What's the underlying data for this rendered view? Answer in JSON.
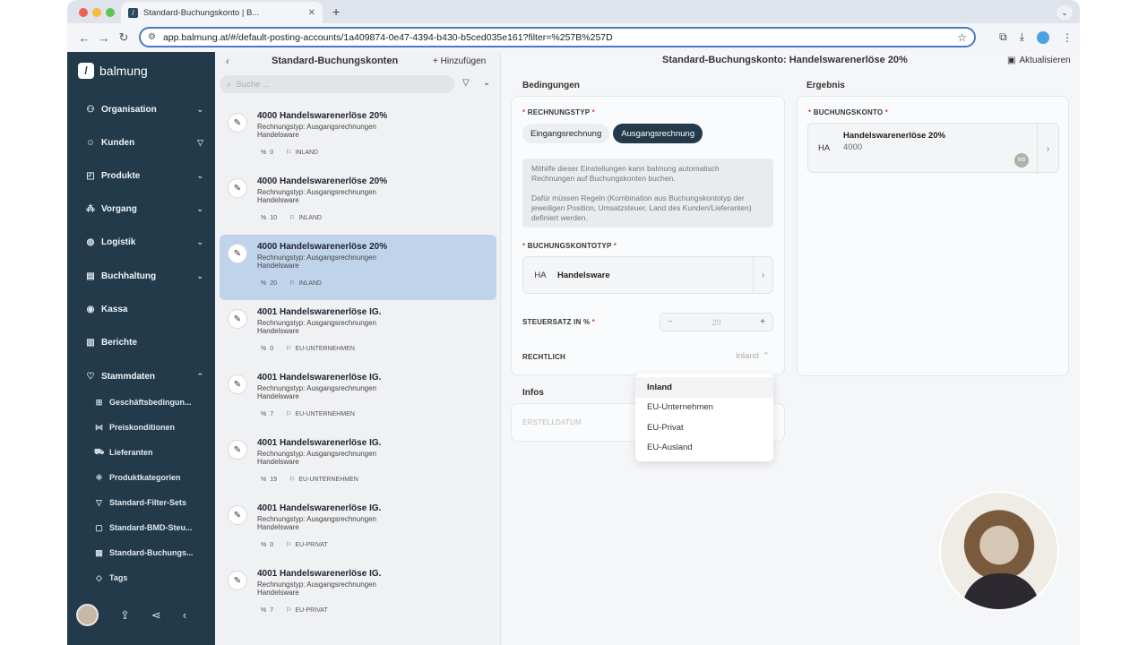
{
  "browser": {
    "tab_title": "Standard-Buchungskonto | B...",
    "url": "app.balmung.at/#/default-posting-accounts/1a409874-0e47-4394-b430-b5ced035e161?filter=%257B%257D"
  },
  "sidebar": {
    "brand": "balmung",
    "items": [
      {
        "label": "Organisation",
        "icon": "org-icon"
      },
      {
        "label": "Kunden",
        "icon": "people-icon"
      },
      {
        "label": "Produkte",
        "icon": "bag-icon"
      },
      {
        "label": "Vorgang",
        "icon": "flow-icon"
      },
      {
        "label": "Logistik",
        "icon": "globe-icon"
      },
      {
        "label": "Buchhaltung",
        "icon": "ledger-icon"
      },
      {
        "label": "Kassa",
        "icon": "coin-icon"
      },
      {
        "label": "Berichte",
        "icon": "chart-icon"
      },
      {
        "label": "Stammdaten",
        "icon": "heart-icon"
      }
    ],
    "subitems": [
      {
        "label": "Geschäftsbedingun..."
      },
      {
        "label": "Preiskonditionen"
      },
      {
        "label": "Lieferanten"
      },
      {
        "label": "Produktkategorien"
      },
      {
        "label": "Standard-Filter-Sets"
      },
      {
        "label": "Standard-BMD-Steu..."
      },
      {
        "label": "Standard-Buchungs..."
      },
      {
        "label": "Tags"
      }
    ]
  },
  "list": {
    "title": "Standard-Buchungskonten",
    "add_label": "Hinzufügen",
    "search_placeholder": "Suche ...",
    "items": [
      {
        "title": "4000 Handelswarenerlöse 20%",
        "line1": "Rechnungstyp: Ausgangsrechnungen",
        "line2": "Handelsware",
        "tax": "0",
        "region": "INLAND"
      },
      {
        "title": "4000 Handelswarenerlöse 20%",
        "line1": "Rechnungstyp: Ausgangsrechnungen",
        "line2": "Handelsware",
        "tax": "10",
        "region": "INLAND"
      },
      {
        "title": "4000 Handelswarenerlöse 20%",
        "line1": "Rechnungstyp: Ausgangsrechnungen",
        "line2": "Handelsware",
        "tax": "20",
        "region": "INLAND"
      },
      {
        "title": "4001 Handelswarenerlöse IG.",
        "line1": "Rechnungstyp: Ausgangsrechnungen",
        "line2": "Handelsware",
        "tax": "0",
        "region": "EU-UNTERNEHMEN"
      },
      {
        "title": "4001 Handelswarenerlöse IG.",
        "line1": "Rechnungstyp: Ausgangsrechnungen",
        "line2": "Handelsware",
        "tax": "7",
        "region": "EU-UNTERNEHMEN"
      },
      {
        "title": "4001 Handelswarenerlöse IG.",
        "line1": "Rechnungstyp: Ausgangsrechnungen",
        "line2": "Handelsware",
        "tax": "19",
        "region": "EU-UNTERNEHMEN"
      },
      {
        "title": "4001 Handelswarenerlöse IG.",
        "line1": "Rechnungstyp: Ausgangsrechnungen",
        "line2": "Handelsware",
        "tax": "0",
        "region": "EU-PRIVAT"
      },
      {
        "title": "4001 Handelswarenerlöse IG.",
        "line1": "Rechnungstyp: Ausgangsrechnungen",
        "line2": "Handelsware",
        "tax": "7",
        "region": "EU-PRIVAT"
      }
    ]
  },
  "detail": {
    "title": "Standard-Buchungskonto: Handelswarenerlöse 20%",
    "refresh_label": "Aktualisieren",
    "conditions_label": "Bedingungen",
    "result_label": "Ergebnis",
    "infos_label": "Infos",
    "invoice_type_label": "RECHNUNGSTYP",
    "invoice_type_options": [
      "Eingangsrechnung",
      "Ausgangsrechnung"
    ],
    "info_text_1": "Mithilfe dieser Einstellungen kann balmung automatisch Rechnungen auf Buchungskonten buchen.",
    "info_text_2": "Dafür müssen Regeln (Kombination aus Buchungskontotyp der jeweiligen Position, Umsatzsteuer, Land des Kunden/Lieferanten) definiert werden.",
    "account_type_label": "BUCHUNGSKONTOTYP",
    "account_type_abbr": "HA",
    "account_type_name": "Handelsware",
    "tax_label": "STEUERSATZ IN %",
    "tax_value": "20",
    "legal_label": "RECHTLICH",
    "legal_value": "Inland",
    "created_label": "ERSTELLDATUM",
    "account_label": "BUCHUNGSKONTO",
    "account_abbr": "HA",
    "account_name": "Handelswarenerlöse 20%",
    "account_number": "4000",
    "account_badge": "MB",
    "dropdown_options": [
      "Inland",
      "EU-Unternehmen",
      "EU-Privat",
      "EU-Ausland"
    ],
    "required_mark": "*"
  }
}
